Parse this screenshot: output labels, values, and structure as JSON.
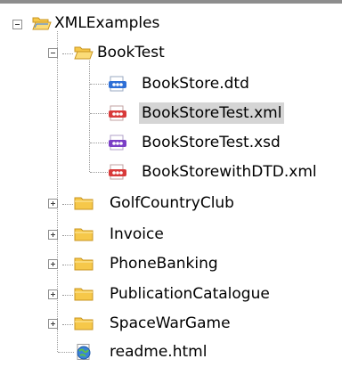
{
  "tree": {
    "root": {
      "label": "XMLExamples",
      "icon": "open-folder-icon",
      "expanded": true
    },
    "folders": [
      {
        "label": "BookTest",
        "icon": "open-folder-icon",
        "expanded": true,
        "children": [
          {
            "label": "BookStore.dtd",
            "icon": "dtd-file-icon",
            "color": "#2e6fd6"
          },
          {
            "label": "BookStoreTest.xml",
            "icon": "xml-file-icon",
            "color": "#d83a3a",
            "selected": true
          },
          {
            "label": "BookStoreTest.xsd",
            "icon": "xsd-file-icon",
            "color": "#7b3fc6"
          },
          {
            "label": "BookStorewithDTD.xml",
            "icon": "xml-file-icon",
            "color": "#d83a3a"
          }
        ]
      },
      {
        "label": "GolfCountryClub",
        "icon": "folder-icon",
        "expanded": false
      },
      {
        "label": "Invoice",
        "icon": "folder-icon",
        "expanded": false
      },
      {
        "label": "PhoneBanking",
        "icon": "folder-icon",
        "expanded": false
      },
      {
        "label": "PublicationCatalogue",
        "icon": "folder-icon",
        "expanded": false
      },
      {
        "label": "SpaceWarGame",
        "icon": "folder-icon",
        "expanded": false
      }
    ],
    "file": {
      "label": "readme.html",
      "icon": "globe-html-icon"
    }
  },
  "colors": {
    "folder": "#f6c84a",
    "folder_edge": "#c89520",
    "selection": "#d5d5d5",
    "tree_lines": "#9a9a9a"
  }
}
